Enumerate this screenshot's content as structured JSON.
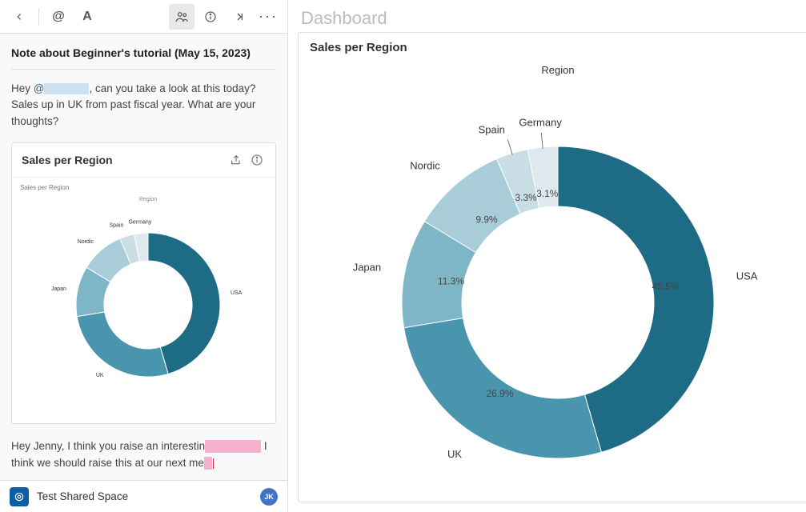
{
  "note": {
    "title": "Note about Beginner's tutorial (May 15, 2023)",
    "body_pre": "Hey ",
    "mention_at": "@",
    "body_post": ", can you take a look at this today? Sales up in UK from past fiscal year. What are your thoughts?",
    "card_title": "Sales per Region",
    "reply_pre": "Hey Jenny, I think you raise an interestin",
    "reply_mid": " I think we should raise this at our next me",
    "reply_cursor": "|"
  },
  "footer": {
    "space": "Test Shared Space",
    "initials": "JK"
  },
  "dashboard": {
    "title": "Dashboard",
    "chart_title": "Sales per Region",
    "legend_title": "Region"
  },
  "chart_data": {
    "type": "pie",
    "title": "Sales per Region",
    "series": [
      {
        "name": "USA",
        "value": 45.5,
        "color": "#1e6b86"
      },
      {
        "name": "UK",
        "value": 26.9,
        "color": "#4895ad"
      },
      {
        "name": "Japan",
        "value": 11.3,
        "color": "#7fb6c7"
      },
      {
        "name": "Nordic",
        "value": 9.9,
        "color": "#a9cdd8"
      },
      {
        "name": "Spain",
        "value": 3.3,
        "color": "#c8dde4"
      },
      {
        "name": "Germany",
        "value": 3.1,
        "color": "#dee9ed"
      }
    ],
    "label_pct": [
      "45.5%",
      "26.9%",
      "11.3%",
      "9.9%",
      "3.3%"
    ]
  }
}
